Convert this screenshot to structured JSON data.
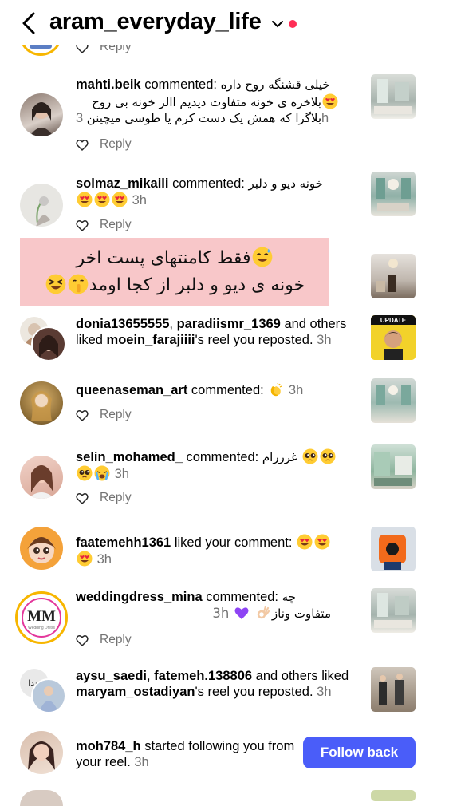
{
  "header": {
    "username": "aram_everyday_life"
  },
  "top": {
    "reply": "Reply"
  },
  "items": [
    {
      "user": "mahti.beik",
      "action": " commented: ",
      "comment_lines": [
        "خیلی قشنگه روح داره",
        "بلاخره ی خونه متفاوت دیدیم االز خونه بی روح",
        "بلاگرا که همش یک دست کرم یا طوسی میچینن"
      ],
      "time": "3h",
      "reply": "Reply"
    },
    {
      "user": "solmaz_mikaili",
      "action": " commented: ",
      "comment": "خونه دیو و دلبر",
      "time": "3h",
      "reply": "Reply"
    },
    {
      "user1": "donia13655555",
      "sep": ", ",
      "user2": "paradiismr_1369",
      "mid": " and others liked ",
      "owner": "moein_farajiiii",
      "tail": "'s reel you reposted.",
      "time": "3h"
    },
    {
      "user": "queenaseman_art",
      "action": " commented: ",
      "time": "3h",
      "reply": "Reply"
    },
    {
      "user": "selin_mohamed_",
      "action": " commented: ",
      "comment": "غرررام",
      "time": "3h",
      "reply": "Reply"
    },
    {
      "user": "faatemehh1361",
      "action": " liked your comment: ",
      "time": "3h"
    },
    {
      "user": "weddingdress_mina",
      "action": " commented: ",
      "comment_a": "چه",
      "comment_b": "متفاوت وناز",
      "time": "3h",
      "reply": "Reply",
      "avatar_text": "MM",
      "avatar_sub": "Wedding Dress"
    },
    {
      "user1": "aysu_saedi",
      "sep": ", ",
      "user2": "fatemeh.138806",
      "mid": " and others liked ",
      "owner": "maryam_ostadiyan",
      "tail": "'s reel you reposted.",
      "time": "3h"
    },
    {
      "user": "moh784_h",
      "action": " started following you from your reel.",
      "time": "3h",
      "button": "Follow back"
    }
  ],
  "banner": {
    "line1": "فقط کامنتهای پست اخر",
    "line2": "خونه ی دیو و دلبر از کجا اومد"
  },
  "thumbs": {
    "update_label": "UPDATE"
  },
  "colors": {
    "accent": "#4a5df9",
    "notification_dot": "#ff2d55",
    "muted_text": "#737373",
    "banner_bg": "#f8c7c9"
  },
  "icons": [
    "back-arrow-icon",
    "chevron-down-icon",
    "heart-icon",
    "heart-eyes-emoji",
    "clapping-hands-emoji",
    "pleading-face-emoji",
    "crying-face-emoji",
    "purple-heart-emoji",
    "ok-hand-emoji",
    "sweat-smile-emoji",
    "shushing-face-emoji",
    "laughing-squint-emoji"
  ]
}
